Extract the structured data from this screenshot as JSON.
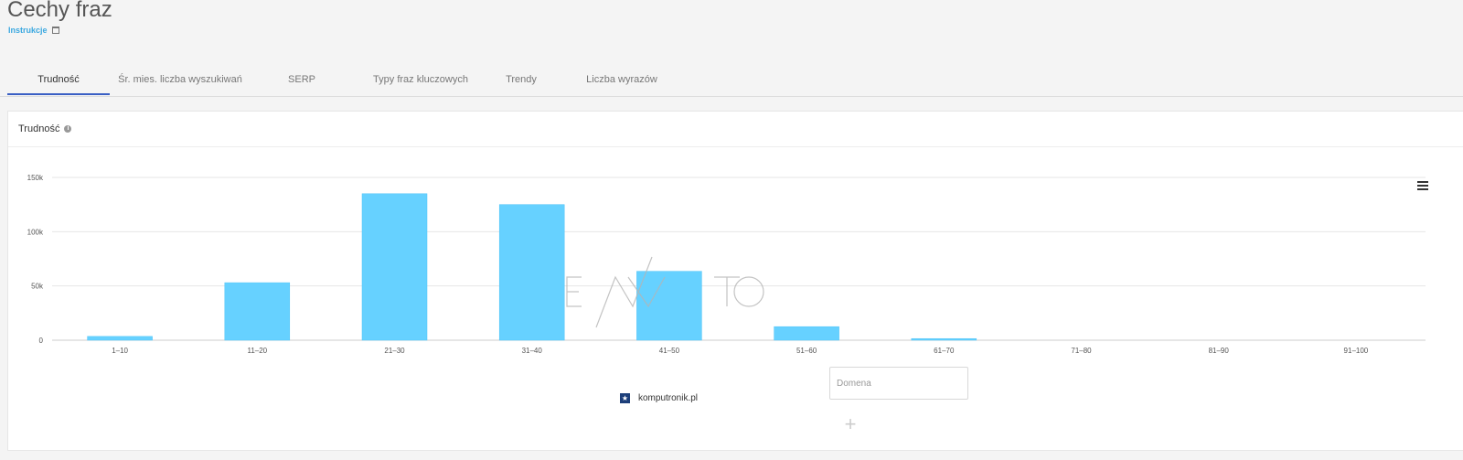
{
  "page": {
    "title": "Cechy fraz",
    "instructions_label": "Instrukcje"
  },
  "tabs": [
    {
      "label": "Trudność",
      "active": true
    },
    {
      "label": "Śr. mies. liczba wyszukiwań",
      "active": false
    },
    {
      "label": "SERP",
      "active": false
    },
    {
      "label": "Typy fraz kluczowych",
      "active": false
    },
    {
      "label": "Trendy",
      "active": false
    },
    {
      "label": "Liczba wyrazów",
      "active": false
    }
  ],
  "card": {
    "title": "Trudność"
  },
  "legend": {
    "label": "komputronik.pl"
  },
  "domain_input": {
    "placeholder": "Domena",
    "value": ""
  },
  "add_button": {
    "label": "+"
  },
  "watermark": {
    "text": "E/\\/\\TO"
  },
  "colors": {
    "bar": "#66d1ff",
    "active_tab_underline": "#3a5fc4",
    "link": "#3ba8e0"
  },
  "chart_data": {
    "type": "bar",
    "categories": [
      "1–10",
      "11–20",
      "21–30",
      "31–40",
      "41–50",
      "51–60",
      "61–70",
      "71–80",
      "81–90",
      "91–100"
    ],
    "series": [
      {
        "name": "komputronik.pl",
        "values": [
          3500,
          53000,
          135000,
          125000,
          63500,
          12500,
          1500,
          0,
          0,
          0
        ]
      }
    ],
    "yticks": [
      "0",
      "50k",
      "100k",
      "150k"
    ],
    "ylim": [
      0,
      150000
    ],
    "grid": true,
    "legend_position": "bottom-center"
  }
}
